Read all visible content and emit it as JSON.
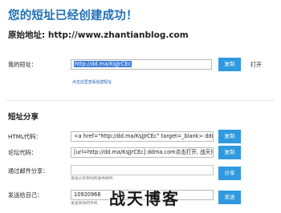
{
  "header": {
    "title": "您的短址已经创建成功！",
    "original_url_label": "原始地址: http://www.zhantianblog.com"
  },
  "short_url": {
    "label": "我的短址：",
    "value": "http://dd.ma/KsJJrCEc",
    "copy_button": "复制",
    "open_link": "打开",
    "sub_link": "点击这里查看创建短址"
  },
  "share": {
    "section_title": "短址分享",
    "html": {
      "label": "HTML代码：",
      "value": "<a href=\"http://dd.ma/KsJJrCEc\" target=_blank> ddma.co",
      "button": "复制"
    },
    "forum": {
      "label": "论坛代码：",
      "value": "[url=http://dd.ma/KsJJrCEc] ddma.com点击打开, 战天博客",
      "button": "复制"
    },
    "email": {
      "label": "通过邮件分享：",
      "value": "",
      "hint": "发送分享到你的收件邮件",
      "button": "分享"
    },
    "self": {
      "label": "发送给自己：",
      "value": "10920966",
      "hint": "发送到你的手机",
      "button": "发送"
    }
  },
  "watermark": {
    "text": "战天博客"
  },
  "colors": {
    "title": "#1d6fb8",
    "button": "#2f9ae0",
    "link": "#1a5ea8",
    "selection": "#3e7cd8"
  }
}
